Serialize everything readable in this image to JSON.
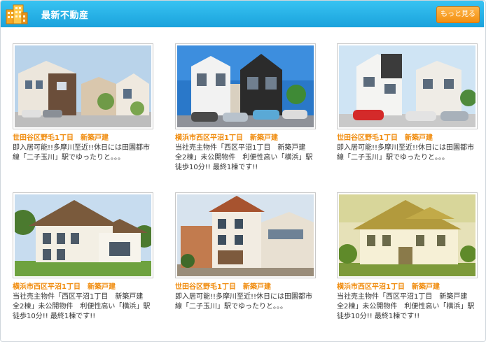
{
  "header": {
    "title": "最新不動産",
    "more_label": "もっと見る"
  },
  "listings": [
    {
      "title": "世田谷区野毛1丁目　新築戸建",
      "desc": "即入居可能!!多摩川至近!!休日には田園都市線「二子玉川」駅でゆったりと。。。"
    },
    {
      "title": "横浜市西区平沼1丁目　新築戸建",
      "desc": "当社売主物件「西区平沼1丁目　新築戸建　全2棟」未公開物件　利便性高い「横浜」駅　徒歩10分!! 最終1棟です!!"
    },
    {
      "title": "世田谷区野毛1丁目　新築戸建",
      "desc": "即入居可能!!多摩川至近!!休日には田園都市線「二子玉川」駅でゆったりと。。。"
    },
    {
      "title": "横浜市西区平沼1丁目　新築戸建",
      "desc": "当社売主物件「西区平沼1丁目　新築戸建　全2棟」未公開物件　利便性高い「横浜」駅　徒歩10分!! 最終1棟です!!"
    },
    {
      "title": "世田谷区野毛1丁目　新築戸建",
      "desc": "即入居可能!!多摩川至近!!休日には田園都市線「二子玉川」駅でゆったりと。。。"
    },
    {
      "title": "横浜市西区平沼1丁目　新築戸建",
      "desc": "当社売主物件「西区平沼1丁目　新築戸建　全2棟」未公開物件　利便性高い「横浜」駅　徒歩10分!! 最終1棟です!!"
    }
  ],
  "colors": {
    "header_bg": "#1aa2dc",
    "accent": "#f08b0c",
    "button": "#f28f10"
  }
}
